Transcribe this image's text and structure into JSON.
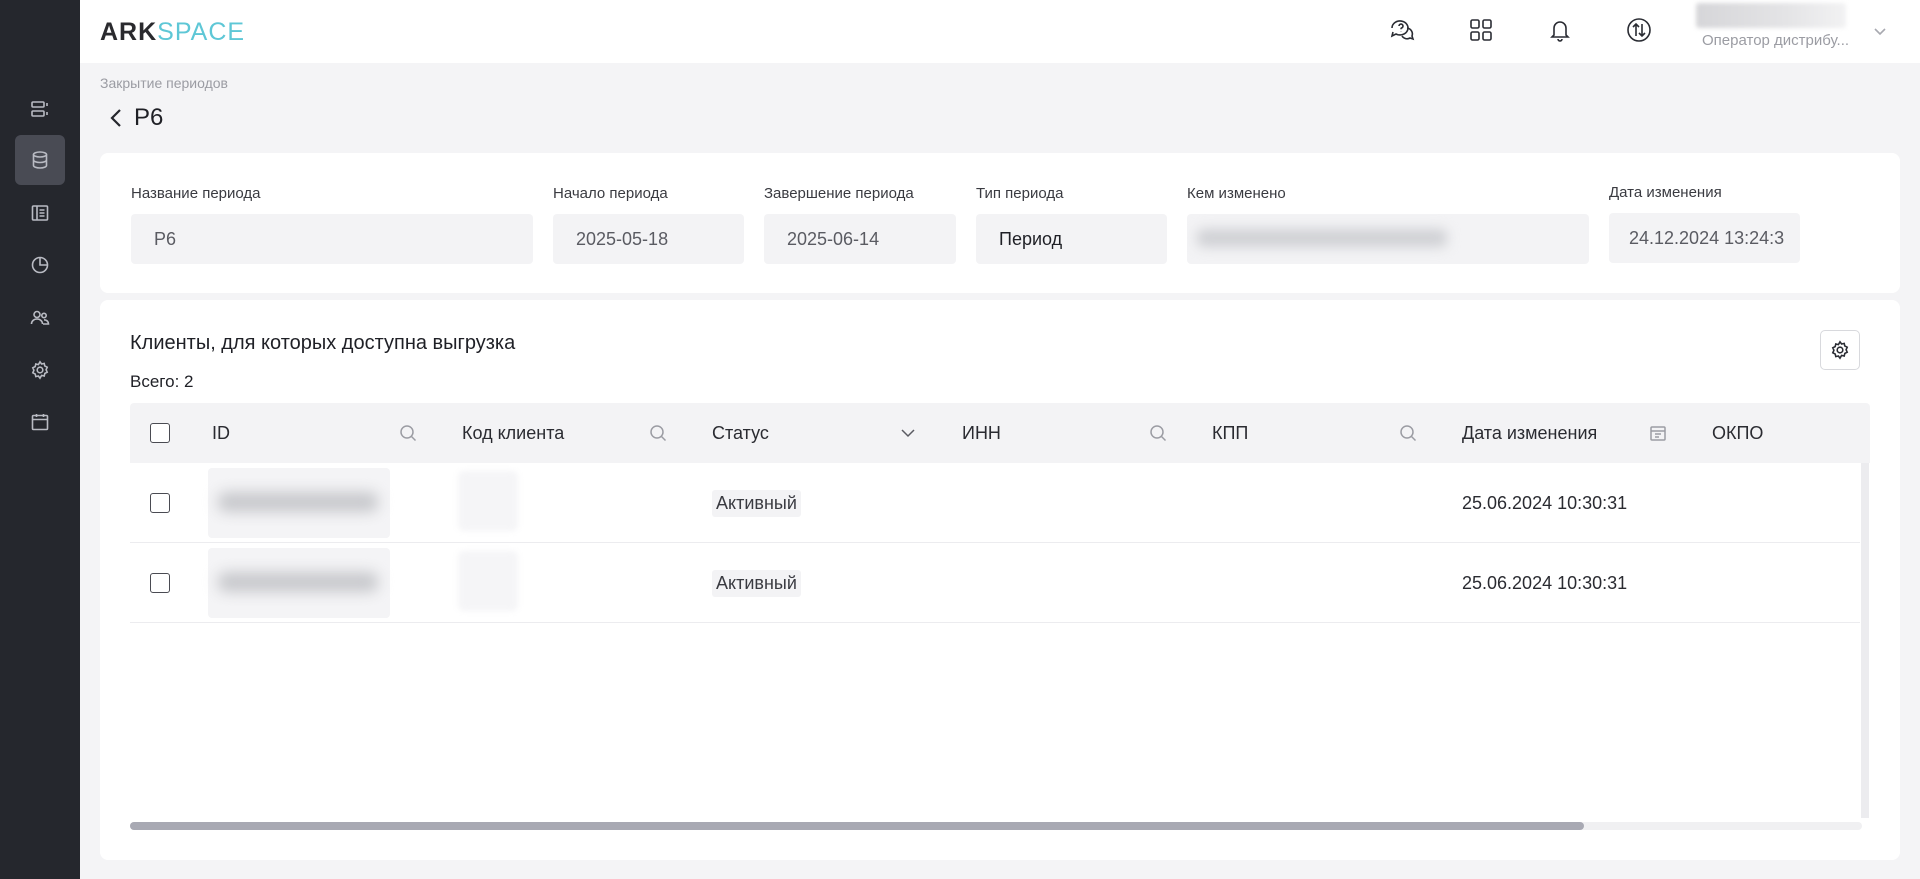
{
  "app": {
    "logo_ark": "ARK",
    "logo_space": "SPACE"
  },
  "header": {
    "user_role": "Оператор дистрибу..."
  },
  "breadcrumb": "Закрытие периодов",
  "page_title": "P6",
  "period": {
    "name_label": "Название периода",
    "name_value": "P6",
    "start_label": "Начало периода",
    "start_value": "2025-05-18",
    "end_label": "Завершение периода",
    "end_value": "2025-06-14",
    "type_label": "Тип периода",
    "type_value": "Период",
    "changed_by_label": "Кем изменено",
    "changed_at_label": "Дата изменения",
    "changed_at_value": "24.12.2024 13:24:3"
  },
  "clients": {
    "title": "Клиенты, для которых доступна выгрузка",
    "total": "Всего: 2",
    "columns": [
      "ID",
      "Код клиента",
      "Статус",
      "ИНН",
      "КПП",
      "Дата изменения",
      "ОКПО"
    ],
    "rows": [
      {
        "status": "Активный",
        "changed_at": "25.06.2024 10:30:31"
      },
      {
        "status": "Активный",
        "changed_at": "25.06.2024 10:30:31"
      }
    ]
  },
  "colors": {
    "sidebar_bg": "#25272d",
    "sidebar_active": "#494b54",
    "logo_accent": "#5ec7d6",
    "page_bg": "#f4f4f6"
  },
  "icons": {
    "sidebar": [
      "list-icon",
      "database-icon",
      "book-icon",
      "pie-chart-icon",
      "users-icon",
      "gear-icon",
      "calendar-icon"
    ],
    "header": [
      "chat-help-icon",
      "apps-grid-icon",
      "bell-icon",
      "sync-icon",
      "chevron-down-icon"
    ]
  }
}
